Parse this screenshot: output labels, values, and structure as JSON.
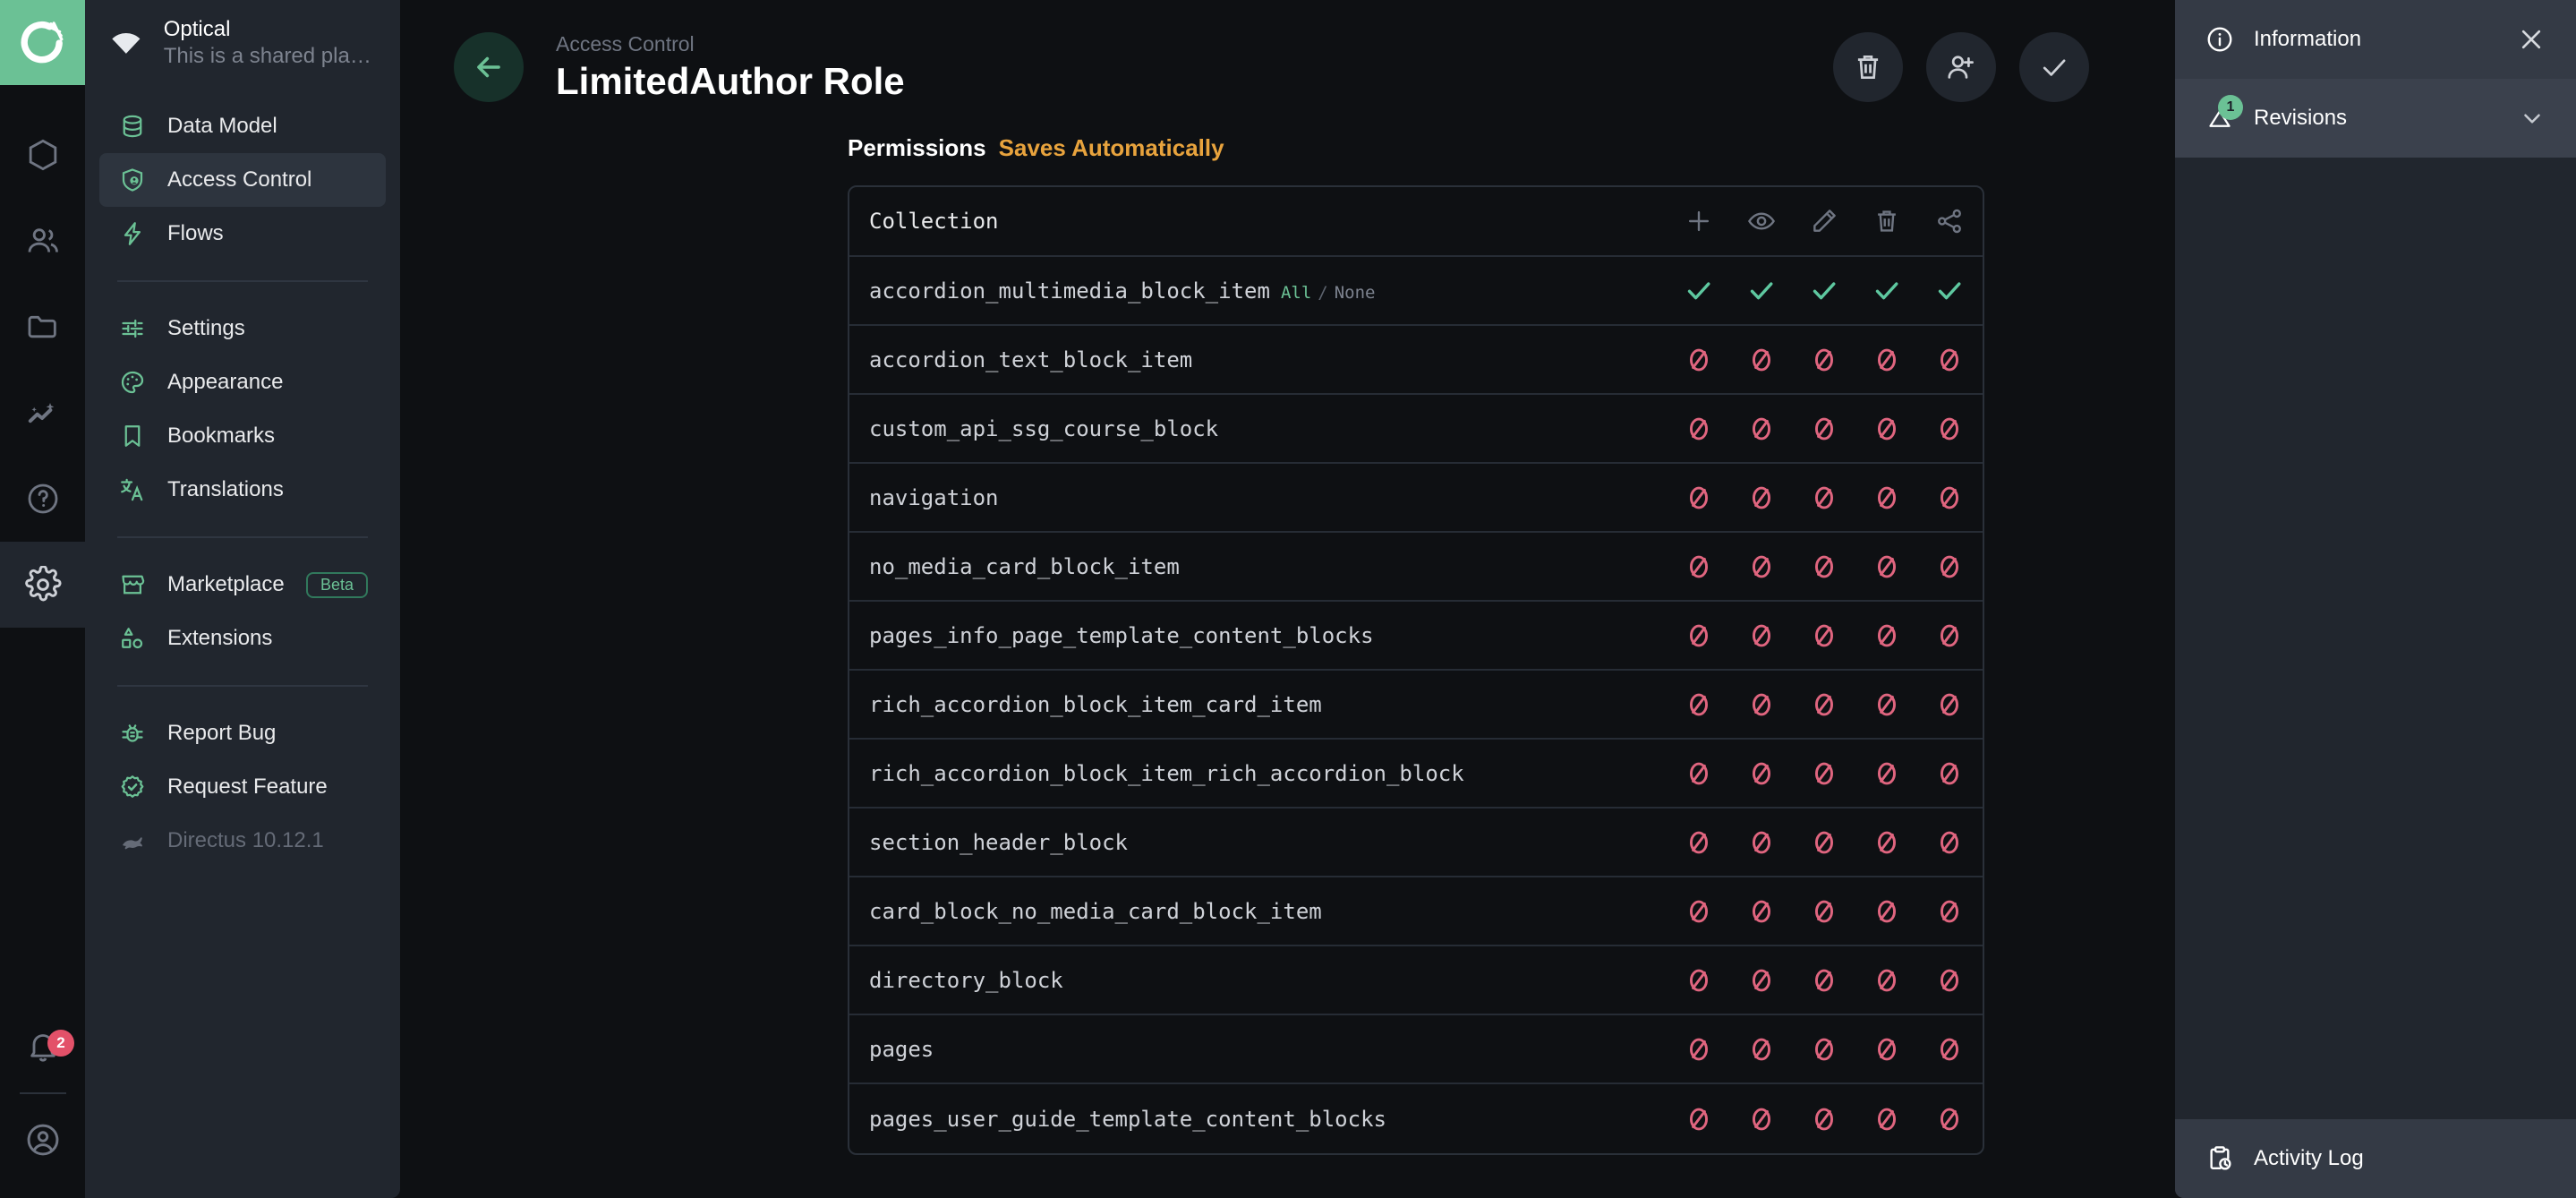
{
  "rail": {
    "logo_icon": "directus-logo-icon",
    "items": [
      {
        "name": "content",
        "icon": "box-icon",
        "active": false
      },
      {
        "name": "users",
        "icon": "people-icon",
        "active": false
      },
      {
        "name": "files",
        "icon": "folder-icon",
        "active": false
      },
      {
        "name": "insights",
        "icon": "sparkle-chart-icon",
        "active": false
      },
      {
        "name": "help",
        "icon": "question-circle-icon",
        "active": false
      },
      {
        "name": "settings",
        "icon": "gear-icon",
        "active": true
      }
    ],
    "notifications_badge": "2",
    "account_icon": "account-circle-icon",
    "bell_icon": "bell-icon"
  },
  "project": {
    "name": "Optical",
    "description": "This is a shared playgr...",
    "icon": "wifi-icon"
  },
  "nav": {
    "groups": [
      {
        "items": [
          {
            "label": "Data Model",
            "icon": "database-icon",
            "active": false
          },
          {
            "label": "Access Control",
            "icon": "shield-user-icon",
            "active": true
          },
          {
            "label": "Flows",
            "icon": "bolt-icon",
            "active": false
          }
        ]
      },
      {
        "items": [
          {
            "label": "Settings",
            "icon": "sliders-icon",
            "active": false
          },
          {
            "label": "Appearance",
            "icon": "palette-icon",
            "active": false
          },
          {
            "label": "Bookmarks",
            "icon": "bookmark-icon",
            "active": false
          },
          {
            "label": "Translations",
            "icon": "translate-icon",
            "active": false
          }
        ]
      },
      {
        "items": [
          {
            "label": "Marketplace",
            "icon": "storefront-icon",
            "badge": "Beta",
            "active": false
          },
          {
            "label": "Extensions",
            "icon": "shapes-icon",
            "active": false
          }
        ]
      },
      {
        "items": [
          {
            "label": "Report Bug",
            "icon": "bug-icon",
            "active": false
          },
          {
            "label": "Request Feature",
            "icon": "verified-badge-icon",
            "active": false
          },
          {
            "label": "Directus 10.12.1",
            "icon": "rabbit-icon",
            "active": false,
            "muted": true
          }
        ]
      }
    ]
  },
  "header": {
    "breadcrumb": "Access Control",
    "title": "LimitedAuthor Role",
    "back_icon": "arrow-left-icon",
    "actions": [
      {
        "name": "delete-role-button",
        "icon": "trash-icon"
      },
      {
        "name": "add-user-button",
        "icon": "person-add-icon"
      },
      {
        "name": "save-button",
        "icon": "check-icon"
      }
    ]
  },
  "permissions": {
    "title": "Permissions",
    "autosave_label": "Saves Automatically",
    "autosave_color": "#e8a33d",
    "column_header": "Collection",
    "action_columns": [
      {
        "name": "create",
        "icon": "plus-icon"
      },
      {
        "name": "read",
        "icon": "eye-icon"
      },
      {
        "name": "update",
        "icon": "pencil-icon"
      },
      {
        "name": "delete",
        "icon": "trash-icon"
      },
      {
        "name": "share",
        "icon": "share-icon"
      }
    ],
    "all_label": "All",
    "separator_label": "/",
    "none_label": "None",
    "allowed_color": "#5ec8a0",
    "denied_color": "#e0657f",
    "rows": [
      {
        "collection": "accordion_multimedia_block_item",
        "show_all_none": true,
        "states": [
          "allowed",
          "allowed",
          "allowed",
          "allowed",
          "allowed"
        ]
      },
      {
        "collection": "accordion_text_block_item",
        "show_all_none": false,
        "states": [
          "denied",
          "denied",
          "denied",
          "denied",
          "denied"
        ]
      },
      {
        "collection": "custom_api_ssg_course_block",
        "show_all_none": false,
        "states": [
          "denied",
          "denied",
          "denied",
          "denied",
          "denied"
        ]
      },
      {
        "collection": "navigation",
        "show_all_none": false,
        "states": [
          "denied",
          "denied",
          "denied",
          "denied",
          "denied"
        ]
      },
      {
        "collection": "no_media_card_block_item",
        "show_all_none": false,
        "states": [
          "denied",
          "denied",
          "denied",
          "denied",
          "denied"
        ]
      },
      {
        "collection": "pages_info_page_template_content_blocks",
        "show_all_none": false,
        "states": [
          "denied",
          "denied",
          "denied",
          "denied",
          "denied"
        ]
      },
      {
        "collection": "rich_accordion_block_item_card_item",
        "show_all_none": false,
        "states": [
          "denied",
          "denied",
          "denied",
          "denied",
          "denied"
        ]
      },
      {
        "collection": "rich_accordion_block_item_rich_accordion_block",
        "show_all_none": false,
        "states": [
          "denied",
          "denied",
          "denied",
          "denied",
          "denied"
        ]
      },
      {
        "collection": "section_header_block",
        "show_all_none": false,
        "states": [
          "denied",
          "denied",
          "denied",
          "denied",
          "denied"
        ]
      },
      {
        "collection": "card_block_no_media_card_block_item",
        "show_all_none": false,
        "states": [
          "denied",
          "denied",
          "denied",
          "denied",
          "denied"
        ]
      },
      {
        "collection": "directory_block",
        "show_all_none": false,
        "states": [
          "denied",
          "denied",
          "denied",
          "denied",
          "denied"
        ]
      },
      {
        "collection": "pages",
        "show_all_none": false,
        "states": [
          "denied",
          "denied",
          "denied",
          "denied",
          "denied"
        ]
      },
      {
        "collection": "pages_user_guide_template_content_blocks",
        "show_all_none": false,
        "states": [
          "denied",
          "denied",
          "denied",
          "denied",
          "denied"
        ]
      }
    ]
  },
  "info_panel": {
    "title": "Information",
    "info_icon": "info-circle-icon",
    "close_icon": "close-icon",
    "revisions_label": "Revisions",
    "revisions_count": "1",
    "revisions_icon": "revisions-icon",
    "chevron_icon": "chevron-down-icon",
    "activity_log_label": "Activity Log",
    "activity_log_icon": "clipboard-clock-icon"
  }
}
